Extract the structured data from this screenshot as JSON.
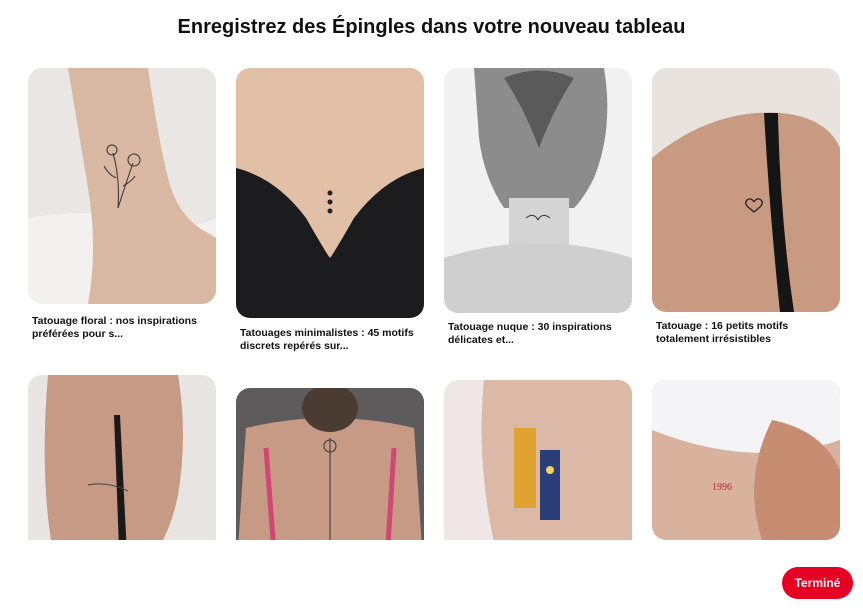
{
  "header": {
    "title": "Enregistrez des Épingles dans votre nouveau tableau"
  },
  "pins": [
    {
      "title": "Tatouage floral : nos inspirations préférées pour s...",
      "image_alt": "floral-ankle-tattoo"
    },
    {
      "title": "Tatouages minimalistes : 45 motifs discrets repérés sur...",
      "image_alt": "three-dots-back-tattoo"
    },
    {
      "title": "Tatouage nuque : 30 inspirations délicates et...",
      "image_alt": "neck-wings-tattoo"
    },
    {
      "title": "Tatouage : 16 petits motifs totalement irrésistibles",
      "image_alt": "heart-shoulder-tattoo"
    },
    {
      "title": "",
      "image_alt": "back-script-tattoo"
    },
    {
      "title": "",
      "image_alt": "spine-flower-tattoo"
    },
    {
      "title": "",
      "image_alt": "van-gogh-arm-tattoo"
    },
    {
      "title": "",
      "image_alt": "rib-red-tattoo"
    }
  ],
  "footer": {
    "done_label": "Terminé"
  },
  "colors": {
    "accent": "#e60023"
  }
}
